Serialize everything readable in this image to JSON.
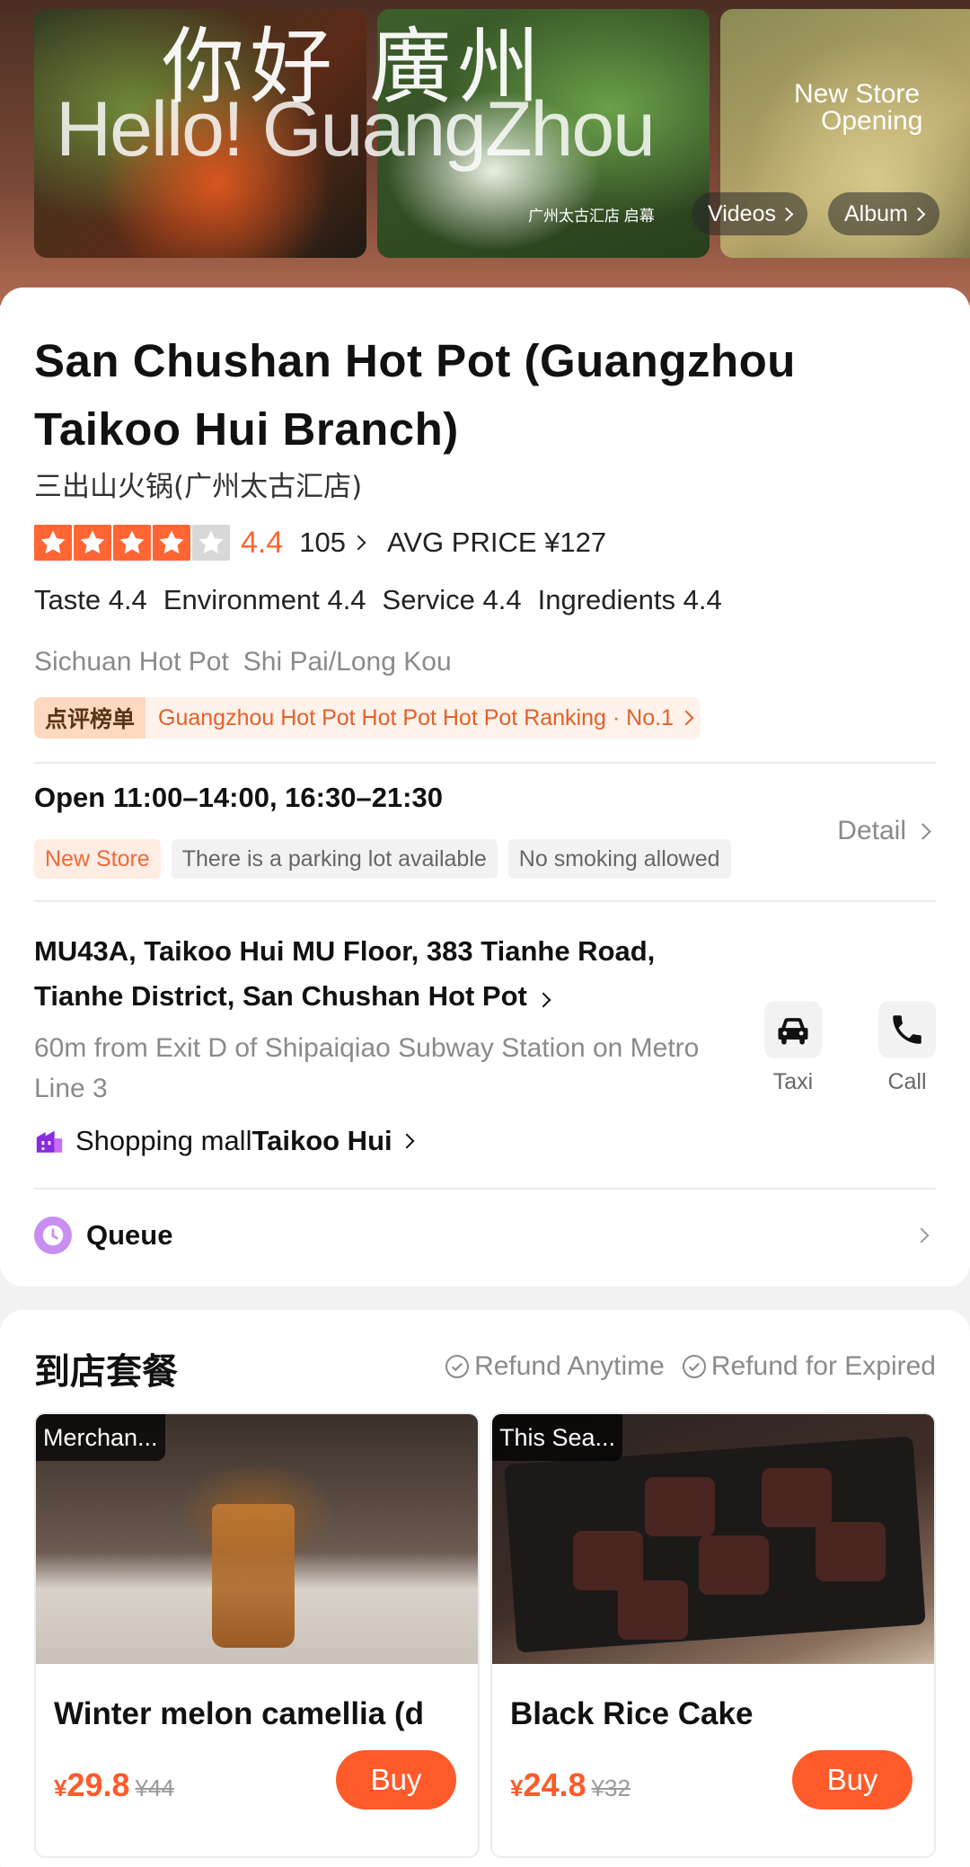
{
  "hero": {
    "cn_text": "你好 廣州",
    "en_text": "Hello! GuangZhou",
    "new_store_line1": "New Store",
    "new_store_line2": "Opening",
    "branch_caption": "广州太古汇店 启幕",
    "videos_label": "Videos",
    "album_label": "Album"
  },
  "store": {
    "title": "San Chushan Hot Pot (Guangzhou Taikoo Hui Branch)",
    "title_cn": "三出山火锅(广州太古汇店)",
    "rating": 4.4,
    "rating_text": "4.4",
    "stars_filled": 4,
    "reviews": "105",
    "avg_price": "AVG PRICE ¥127",
    "subscores": [
      {
        "label": "Taste 4.4"
      },
      {
        "label": "Environment 4.4"
      },
      {
        "label": "Service 4.4"
      },
      {
        "label": "Ingredients 4.4"
      }
    ],
    "categories": [
      "Sichuan Hot Pot",
      "Shi Pai/Long Kou"
    ],
    "ranking_badge": "点评榜单",
    "ranking_text": "Guangzhou Hot Pot Hot Pot Hot Pot Ranking · No.1",
    "hours": "Open  11:00–14:00, 16:30–21:30",
    "features": [
      "New Store",
      "There is a parking lot available",
      "No smoking allowed"
    ],
    "detail_label": "Detail",
    "address": "MU43A, Taikoo Hui MU Floor, 383 Tianhe Road, Tianhe District, San Chushan Hot Pot",
    "metro": "60m from Exit D of Shipaiqiao Subway Station on Metro Line 3",
    "taxi_label": "Taxi",
    "call_label": "Call",
    "mall_prefix": "Shopping mall",
    "mall_name": "Taikoo Hui",
    "queue_label": "Queue"
  },
  "packages": {
    "title": "到店套餐",
    "refund_anytime": "Refund Anytime",
    "refund_expired": "Refund for Expired",
    "items": [
      {
        "badge": "Merchan...",
        "name": "Winter melon camellia (d",
        "price": "29.8",
        "currency": "¥",
        "original": "¥44",
        "buy": "Buy"
      },
      {
        "badge": "This Sea...",
        "name": "Black Rice Cake",
        "price": "24.8",
        "currency": "¥",
        "original": "¥32",
        "buy": "Buy"
      }
    ]
  },
  "colors": {
    "accent": "#ff5a2a",
    "rating_orange": "#ff6633",
    "queue_purple": "#c88ff0",
    "mall_purple": "#8a2be2"
  }
}
